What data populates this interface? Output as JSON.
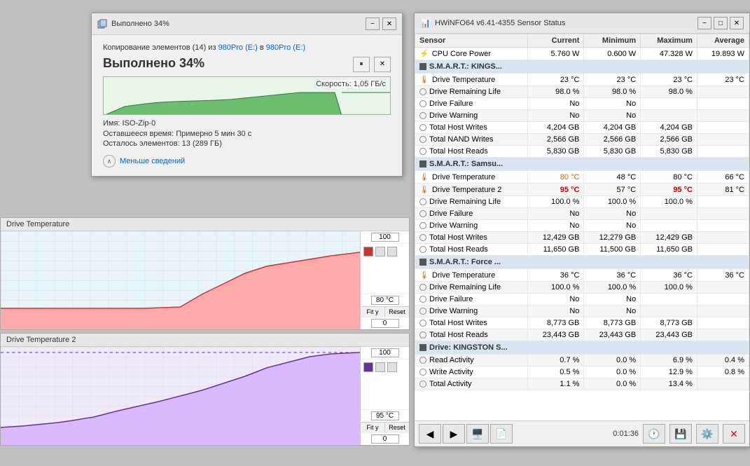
{
  "copy_dialog": {
    "title": "Выполнено 34%",
    "copy_from_prefix": "Копирование элементов (14) из ",
    "copy_from_source": "980Pro (E:)",
    "copy_from_middle": " в ",
    "copy_from_dest": "980Pro (E:)",
    "progress_title": "Выполнено 34%",
    "speed": "Скорость: 1,05 ГБ/с",
    "file_name": "Имя: ISO-Zip-0",
    "time_remaining": "Оставшееся время: Примерно 5 мин 30 с",
    "items_remaining": "Осталось элементов: 13 (289 ГБ)",
    "more_info": "Меньше сведений",
    "pause_btn": "⏸",
    "close_btn": "✕",
    "win_minimize": "−",
    "win_close": "✕"
  },
  "hw_window": {
    "title": "HWiNFO64 v6.41-4355 Sensor Status",
    "win_minimize": "−",
    "win_restore": "□",
    "win_close": "✕",
    "table": {
      "headers": [
        "Sensor",
        "Current",
        "Minimum",
        "Maximum",
        "Average"
      ],
      "rows": [
        {
          "type": "data",
          "indent": true,
          "name": "CPU Core Power",
          "current": "5.760 W",
          "minimum": "0.600 W",
          "maximum": "47.328 W",
          "average": "19.893 W",
          "icon": "cpu"
        },
        {
          "type": "section",
          "name": "S.M.A.R.T.: KINGS...",
          "icon": "hdd"
        },
        {
          "type": "data",
          "indent": true,
          "name": "Drive Temperature",
          "current": "23 °C",
          "minimum": "23 °C",
          "maximum": "23 °C",
          "average": "23 °C",
          "icon": "temp"
        },
        {
          "type": "data",
          "indent": true,
          "name": "Drive Remaining Life",
          "current": "98.0 %",
          "minimum": "98.0 %",
          "maximum": "98.0 %",
          "average": "",
          "icon": "circle"
        },
        {
          "type": "data",
          "indent": true,
          "name": "Drive Failure",
          "current": "No",
          "minimum": "No",
          "maximum": "",
          "average": "",
          "icon": "circle"
        },
        {
          "type": "data",
          "indent": true,
          "name": "Drive Warning",
          "current": "No",
          "minimum": "No",
          "maximum": "",
          "average": "",
          "icon": "circle"
        },
        {
          "type": "data",
          "indent": true,
          "name": "Total Host Writes",
          "current": "4,204 GB",
          "minimum": "4,204 GB",
          "maximum": "4,204 GB",
          "average": "",
          "icon": "circle"
        },
        {
          "type": "data",
          "indent": true,
          "name": "Total NAND Writes",
          "current": "2,566 GB",
          "minimum": "2,566 GB",
          "maximum": "2,566 GB",
          "average": "",
          "icon": "circle"
        },
        {
          "type": "data",
          "indent": true,
          "name": "Total Host Reads",
          "current": "5,830 GB",
          "minimum": "5,830 GB",
          "maximum": "5,830 GB",
          "average": "",
          "icon": "circle"
        },
        {
          "type": "section",
          "name": "S.M.A.R.T.: Samsu...",
          "icon": "hdd"
        },
        {
          "type": "data",
          "indent": true,
          "name": "Drive Temperature",
          "current": "80 °C",
          "minimum": "48 °C",
          "maximum": "80 °C",
          "average": "66 °C",
          "icon": "temp",
          "current_color": "orange"
        },
        {
          "type": "data",
          "indent": true,
          "name": "Drive Temperature 2",
          "current": "95 °C",
          "minimum": "57 °C",
          "maximum": "95 °C",
          "average": "81 °C",
          "icon": "temp",
          "current_color": "red",
          "maximum_color": "red"
        },
        {
          "type": "data",
          "indent": true,
          "name": "Drive Remaining Life",
          "current": "100.0 %",
          "minimum": "100.0 %",
          "maximum": "100.0 %",
          "average": "",
          "icon": "circle"
        },
        {
          "type": "data",
          "indent": true,
          "name": "Drive Failure",
          "current": "No",
          "minimum": "No",
          "maximum": "",
          "average": "",
          "icon": "circle"
        },
        {
          "type": "data",
          "indent": true,
          "name": "Drive Warning",
          "current": "No",
          "minimum": "No",
          "maximum": "",
          "average": "",
          "icon": "circle"
        },
        {
          "type": "data",
          "indent": true,
          "name": "Total Host Writes",
          "current": "12,429 GB",
          "minimum": "12,279 GB",
          "maximum": "12,429 GB",
          "average": "",
          "icon": "circle"
        },
        {
          "type": "data",
          "indent": true,
          "name": "Total Host Reads",
          "current": "11,650 GB",
          "minimum": "11,500 GB",
          "maximum": "11,650 GB",
          "average": "",
          "icon": "circle"
        },
        {
          "type": "section",
          "name": "S.M.A.R.T.: Force ...",
          "icon": "hdd"
        },
        {
          "type": "data",
          "indent": true,
          "name": "Drive Temperature",
          "current": "36 °C",
          "minimum": "36 °C",
          "maximum": "36 °C",
          "average": "36 °C",
          "icon": "temp"
        },
        {
          "type": "data",
          "indent": true,
          "name": "Drive Remaining Life",
          "current": "100.0 %",
          "minimum": "100.0 %",
          "maximum": "100.0 %",
          "average": "",
          "icon": "circle"
        },
        {
          "type": "data",
          "indent": true,
          "name": "Drive Failure",
          "current": "No",
          "minimum": "No",
          "maximum": "",
          "average": "",
          "icon": "circle"
        },
        {
          "type": "data",
          "indent": true,
          "name": "Drive Warning",
          "current": "No",
          "minimum": "No",
          "maximum": "",
          "average": "",
          "icon": "circle"
        },
        {
          "type": "data",
          "indent": true,
          "name": "Total Host Writes",
          "current": "8,773 GB",
          "minimum": "8,773 GB",
          "maximum": "8,773 GB",
          "average": "",
          "icon": "circle"
        },
        {
          "type": "data",
          "indent": true,
          "name": "Total Host Reads",
          "current": "23,443 GB",
          "minimum": "23,443 GB",
          "maximum": "23,443 GB",
          "average": "",
          "icon": "circle"
        },
        {
          "type": "section",
          "name": "Drive: KINGSTON S...",
          "icon": "hdd"
        },
        {
          "type": "data",
          "indent": true,
          "name": "Read Activity",
          "current": "0.7 %",
          "minimum": "0.0 %",
          "maximum": "6.9 %",
          "average": "0.4 %",
          "icon": "circle"
        },
        {
          "type": "data",
          "indent": true,
          "name": "Write Activity",
          "current": "0.5 %",
          "minimum": "0.0 %",
          "maximum": "12.9 %",
          "average": "0.8 %",
          "icon": "circle"
        },
        {
          "type": "data",
          "indent": true,
          "name": "Total Activity",
          "current": "1.1 %",
          "minimum": "0.0 %",
          "maximum": "13.4 %",
          "average": "",
          "icon": "circle"
        }
      ]
    },
    "toolbar": {
      "back_btn": "◀",
      "forward_btn": "▶",
      "time": "0:01:36"
    }
  },
  "graphs": [
    {
      "title": "Drive Temperature",
      "max_value": "100",
      "mid_value": "80 °C",
      "min_value": "0",
      "color": "#cc3333",
      "fit_btn": "Fit y",
      "reset_btn": "Reset"
    },
    {
      "title": "Drive Temperature 2",
      "max_value": "100",
      "mid_value": "95 °C",
      "min_value": "0",
      "color": "#663399",
      "fit_btn": "Fit y",
      "reset_btn": "Reset"
    }
  ]
}
